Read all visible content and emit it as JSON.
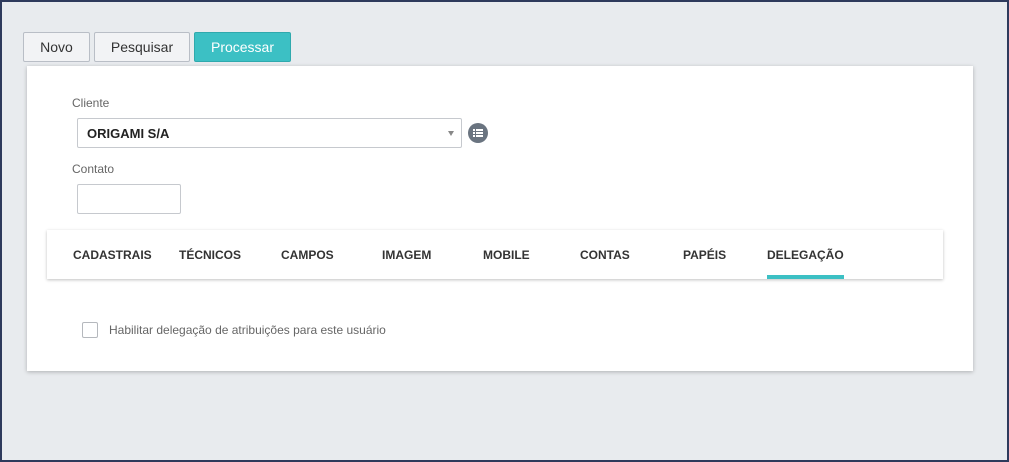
{
  "toolbar": {
    "novo_label": "Novo",
    "pesquisar_label": "Pesquisar",
    "processar_label": "Processar"
  },
  "form": {
    "cliente_label": "Cliente",
    "cliente_value": "ORIGAMI S/A",
    "contato_label": "Contato",
    "contato_value": ""
  },
  "tabs": [
    {
      "label": "CADASTRAIS"
    },
    {
      "label": "TÉCNICOS"
    },
    {
      "label": "CAMPOS"
    },
    {
      "label": "IMAGEM"
    },
    {
      "label": "MOBILE"
    },
    {
      "label": "CONTAS"
    },
    {
      "label": "PAPÉIS"
    },
    {
      "label": "DELEGAÇÃO",
      "active": true
    }
  ],
  "delegacao": {
    "checkbox_label": "Habilitar delegação de atribuições para este usuário",
    "checked": false
  },
  "colors": {
    "accent": "#3cc0c4",
    "frame": "#2e3a5c",
    "background": "#e8ebee"
  },
  "icons": {
    "cliente_list": "list-icon",
    "select_caret": "caret-down-icon"
  }
}
